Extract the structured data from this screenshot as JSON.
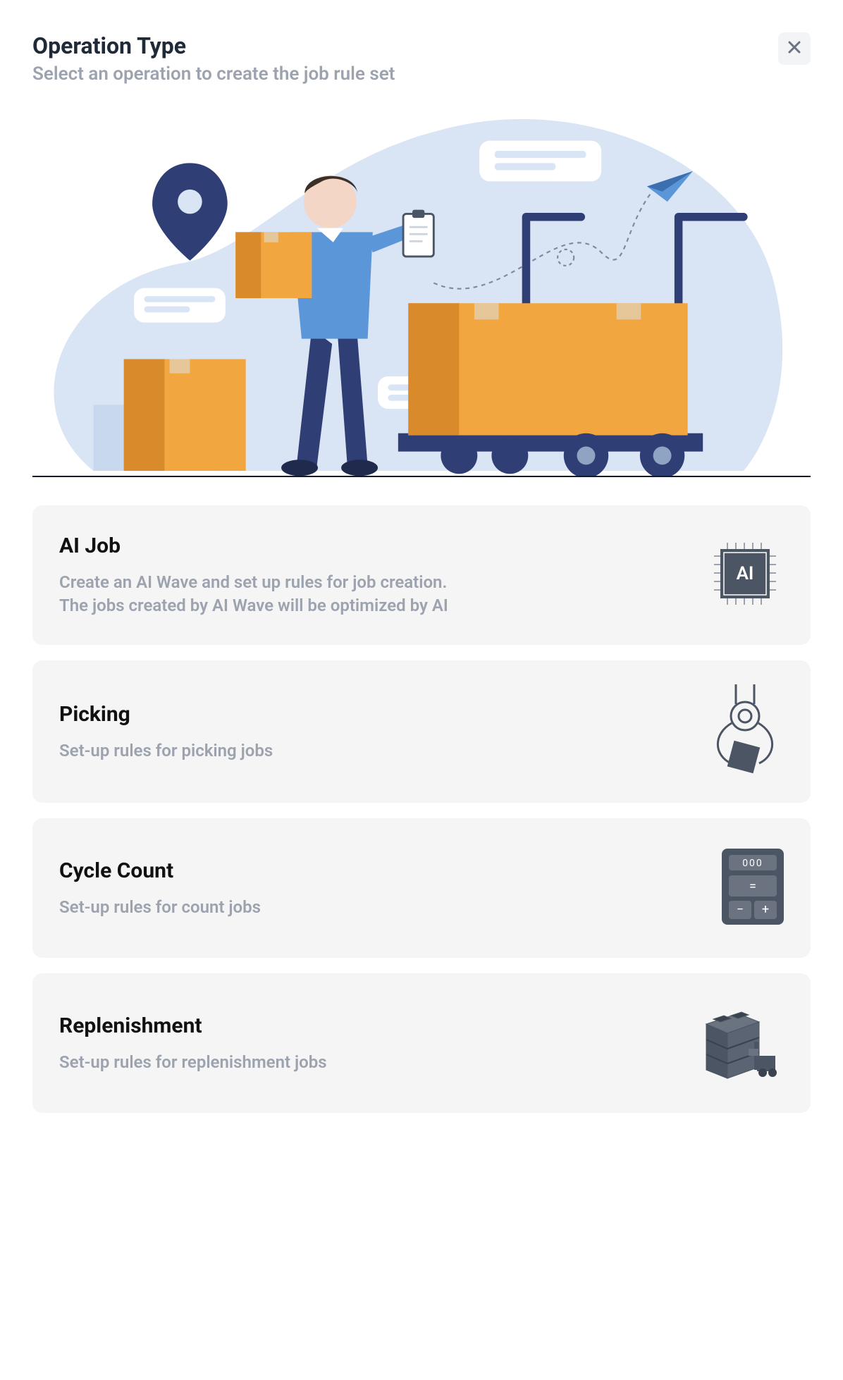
{
  "header": {
    "title": "Operation Type",
    "subtitle": "Select an operation to create the job rule set"
  },
  "options": [
    {
      "id": "ai-job",
      "title": "AI Job",
      "description": "Create an AI Wave and set up rules for job creation. The jobs created by AI Wave will be optimized by AI",
      "icon": "ai-chip-icon"
    },
    {
      "id": "picking",
      "title": "Picking",
      "description": "Set-up rules for picking jobs",
      "icon": "claw-icon"
    },
    {
      "id": "cycle-count",
      "title": "Cycle Count",
      "description": "Set-up rules for count jobs",
      "icon": "calculator-icon"
    },
    {
      "id": "replenishment",
      "title": "Replenishment",
      "description": "Set-up rules for replenishment jobs",
      "icon": "shelving-icon"
    }
  ],
  "colors": {
    "slate": "#4b5563",
    "slateLight": "#6b7280",
    "blueBg": "#d9e4f5",
    "orange": "#f2a640",
    "orangeDark": "#d98a2b",
    "navy": "#2f3e75",
    "skin": "#f4d6c6",
    "shirt": "#5a96d8"
  }
}
